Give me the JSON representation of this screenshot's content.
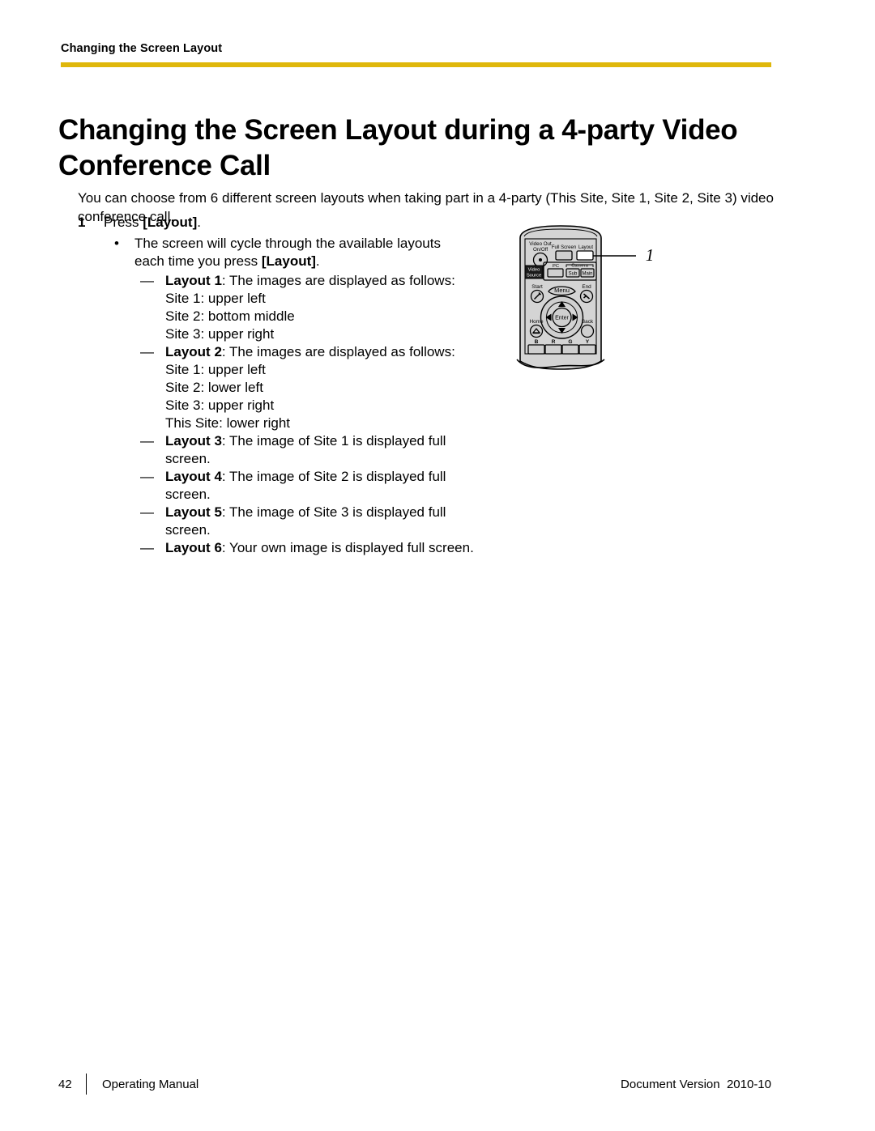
{
  "header": {
    "running_title": "Changing the Screen Layout",
    "rule_color": "#dfb70b"
  },
  "title": "Changing the Screen Layout during a 4-party Video Conference Call",
  "intro": "You can choose from 6 different screen layouts when taking part in a 4-party (This Site, Site 1, Site 2, Site 3) video conference call.",
  "steps": [
    {
      "number": "1",
      "text_before": "Press ",
      "text_bold": "[Layout]",
      "text_after": ".",
      "bullet": {
        "mark": "•",
        "part1": "The screen will cycle through the available layouts each time you press ",
        "bold": "[Layout]",
        "part2": "."
      },
      "sublist_mark": "—",
      "sublist": [
        {
          "bold": "Layout 1",
          "rest": ": The images are displayed as follows:",
          "details": [
            "Site 1: upper left",
            "Site 2: bottom middle",
            "Site 3: upper right"
          ]
        },
        {
          "bold": "Layout 2",
          "rest": ": The images are displayed as follows:",
          "details": [
            "Site 1: upper left",
            "Site 2: lower left",
            "Site 3: upper right",
            "This Site: lower right"
          ]
        },
        {
          "bold": "Layout 3",
          "rest": ": The image of Site 1 is displayed full screen.",
          "details": []
        },
        {
          "bold": "Layout 4",
          "rest": ": The image of Site 2 is displayed full screen.",
          "details": []
        },
        {
          "bold": "Layout 5",
          "rest": ": The image of Site 3 is displayed full screen.",
          "details": []
        },
        {
          "bold": "Layout 6",
          "rest": ": Your own image is displayed full screen.",
          "details": []
        }
      ]
    }
  ],
  "illustration": {
    "callout_number": "1",
    "labels": {
      "video_out": "Video Out",
      "on_off": "On/Off",
      "full_screen": "Full Screen",
      "layout": "Layout",
      "video_source_line1": "Video",
      "video_source_line2": "Source",
      "pc": "PC",
      "camera": "Camera",
      "sub": "Sub",
      "main": "Main",
      "start": "Start",
      "menu": "Menu",
      "end": "End",
      "enter": "Enter",
      "home": "Home",
      "back": "Back",
      "color_b": "B",
      "color_r": "R",
      "color_g": "G",
      "color_y": "Y"
    }
  },
  "footer": {
    "page_number": "42",
    "manual_name": "Operating Manual",
    "document_version": "Document Version  2010-10"
  }
}
